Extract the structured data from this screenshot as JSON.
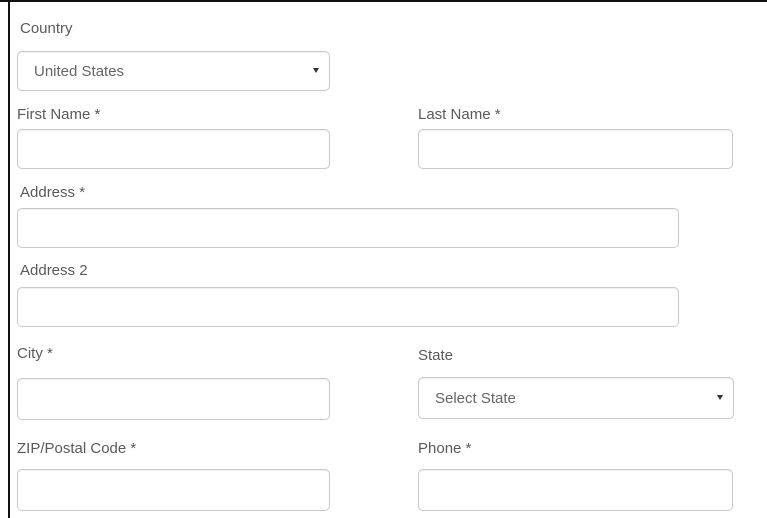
{
  "form": {
    "country": {
      "label": "Country",
      "selected": "United States"
    },
    "first_name": {
      "label": "First Name *",
      "value": ""
    },
    "last_name": {
      "label": "Last Name *",
      "value": ""
    },
    "address": {
      "label": "Address *",
      "value": ""
    },
    "address2": {
      "label": "Address 2",
      "value": ""
    },
    "city": {
      "label": "City *",
      "value": ""
    },
    "state": {
      "label": "State",
      "selected": "Select State"
    },
    "zip": {
      "label": "ZIP/Postal Code *",
      "value": ""
    },
    "phone": {
      "label": "Phone *",
      "value": ""
    }
  }
}
